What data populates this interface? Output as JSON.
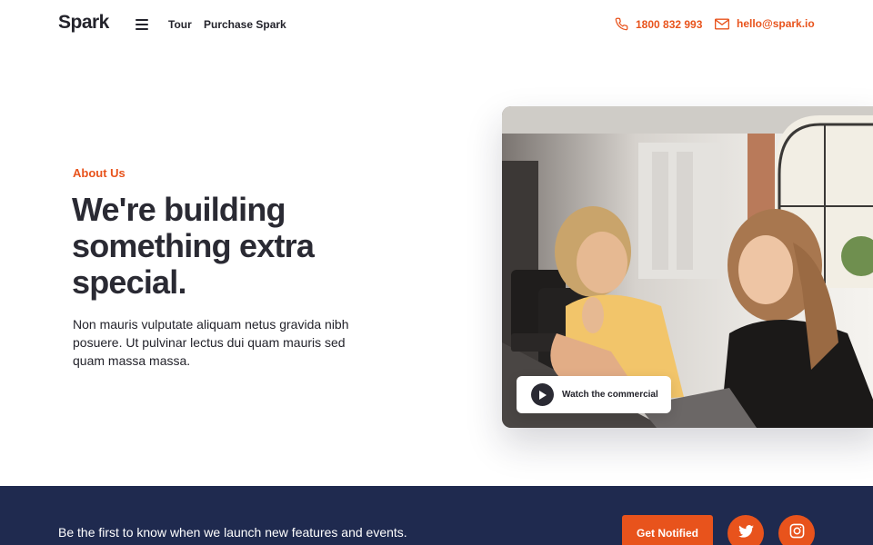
{
  "header": {
    "logo": "Spark",
    "menu_icon": "hamburger-menu-icon",
    "nav": [
      {
        "label": "Tour"
      },
      {
        "label": "Purchase Spark"
      }
    ],
    "phone": {
      "icon": "phone-icon",
      "text": "1800 832 993"
    },
    "email": {
      "icon": "mail-icon",
      "text": "hello@spark.io"
    }
  },
  "hero": {
    "eyebrow": "About Us",
    "headline": "We're building something extra special.",
    "body": "Non mauris vulputate aliquam netus gravida nibh posuere. Ut pulvinar lectus dui quam mauris sed quam massa massa.",
    "watch_button": {
      "icon": "play-icon",
      "label": "Watch the commercial"
    }
  },
  "band": {
    "text": "Be the first to know when we launch new features and events.",
    "notify_button": "Get Notified",
    "social": [
      {
        "icon": "twitter-icon"
      },
      {
        "icon": "instagram-icon"
      }
    ]
  },
  "colors": {
    "accent": "#e8531c",
    "dark_text": "#23232b",
    "band_background": "#1f2a4f"
  }
}
